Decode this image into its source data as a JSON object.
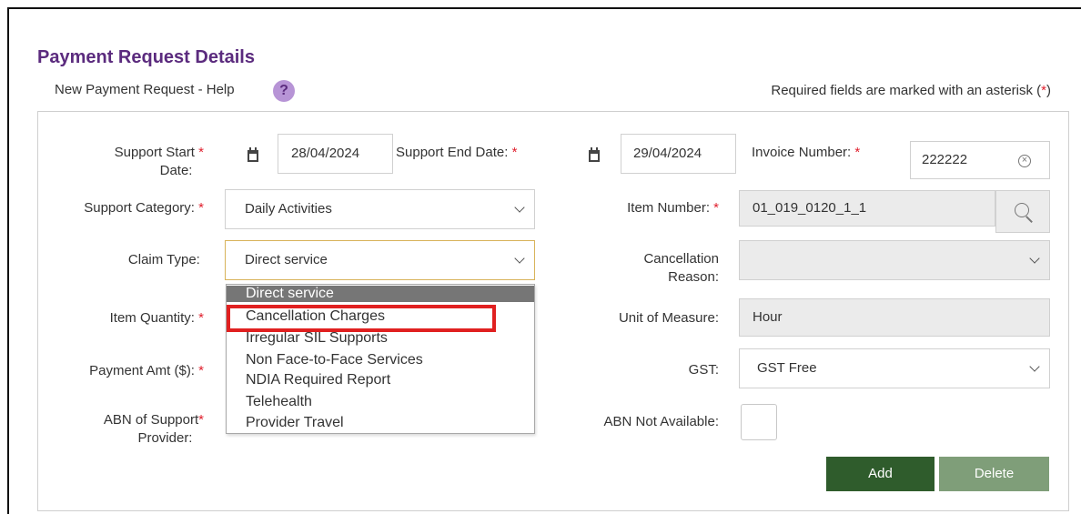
{
  "header": {
    "title": "Payment Request Details",
    "help_link": "New Payment Request - Help",
    "help_icon_glyph": "?",
    "required_note": "Required fields are marked with an asterisk (",
    "required_star": "*",
    "required_note_end": ")"
  },
  "form": {
    "support_start_label_line1": "Support Start",
    "support_start_label_line2": "Date:",
    "support_start_value": "28/04/2024",
    "support_end_label": "Support End Date:",
    "support_end_value": "29/04/2024",
    "invoice_label": "Invoice Number:",
    "invoice_value": "222222",
    "clear_glyph": "×",
    "support_category_label": "Support Category:",
    "support_category_value": "Daily Activities",
    "item_number_label": "Item Number:",
    "item_number_value": "01_019_0120_1_1",
    "claim_type_label": "Claim Type:",
    "claim_type_value": "Direct service",
    "cancellation_label_line1": "Cancellation",
    "cancellation_label_line2": "Reason:",
    "item_quantity_label": "Item Quantity:",
    "unit_label": "Unit of Measure:",
    "unit_value": "Hour",
    "payment_label": "Payment Amt ($):",
    "gst_label": "GST:",
    "gst_value": "GST Free",
    "abn_label_line1": "ABN of Support",
    "abn_label_line2": "Provider:",
    "abn_na_label": "ABN Not Available:",
    "required_star": "*"
  },
  "claim_type_options": [
    "Direct service",
    "Cancellation Charges",
    "Irregular SIL Supports",
    "Non Face-to-Face Services",
    "NDIA Required Report",
    "Telehealth",
    "Provider Travel"
  ],
  "buttons": {
    "add": "Add",
    "delete": "Delete"
  },
  "colors": {
    "title": "#5b2b7e",
    "required_star": "#e0202e",
    "add_button": "#2f5c2c",
    "delete_button": "#7f9e79",
    "highlight_box": "#e02020"
  },
  "icons": {
    "calendar": "calendar-icon",
    "help": "help-icon",
    "search": "search-icon",
    "clear": "clear-icon",
    "chevron": "chevron-down-icon"
  }
}
